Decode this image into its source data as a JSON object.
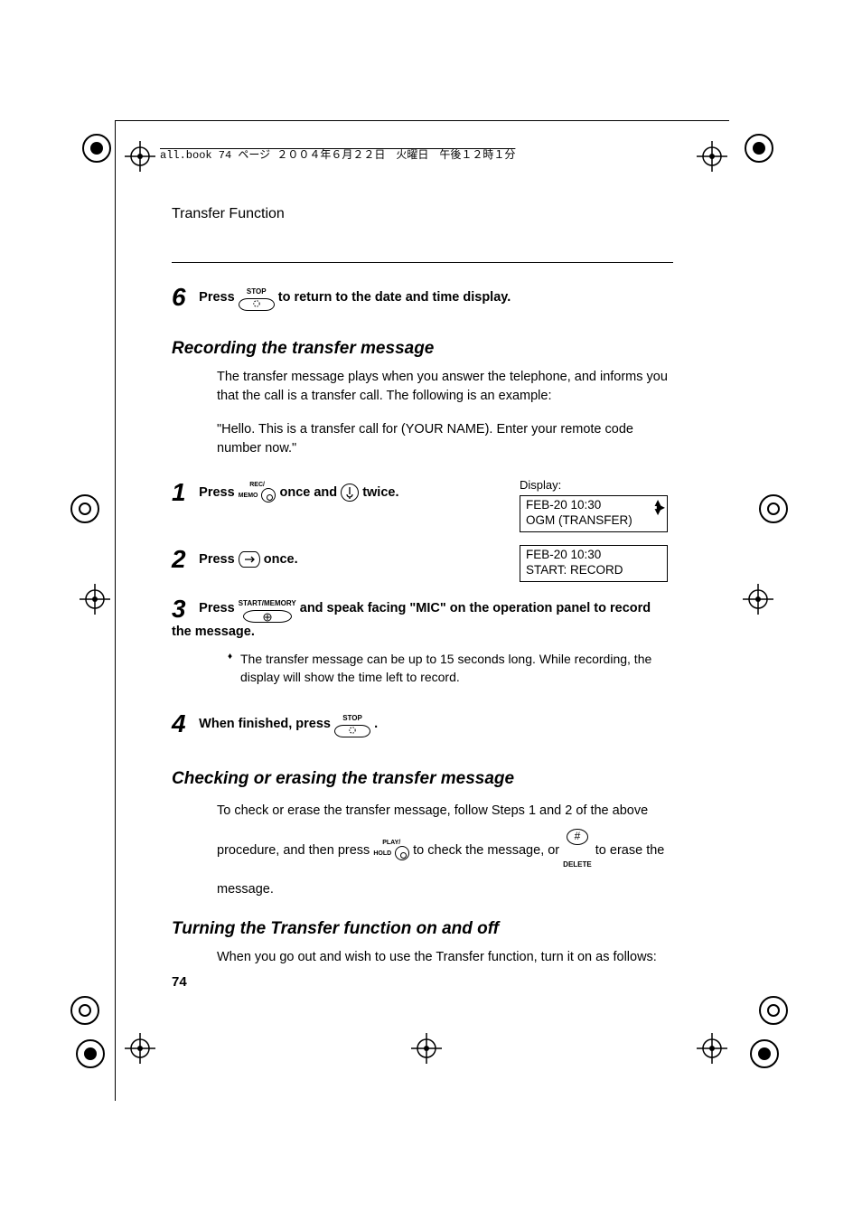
{
  "header": {
    "book_line": "all.book  74 ページ  ２００４年６月２２日　火曜日　午後１２時１分"
  },
  "section_title": "Transfer Function",
  "step6": {
    "num": "6",
    "before": "Press  ",
    "btn_label": "STOP",
    "after": "  to return to the date and time display."
  },
  "recording": {
    "heading": "Recording the transfer message",
    "para1": "The transfer message plays when you answer the telephone, and informs you that the call is a transfer call. The following is an example:",
    "para2": "\"Hello. This is a transfer call for (YOUR NAME). Enter your remote code number now.\""
  },
  "display_label": "Display:",
  "step1": {
    "num": "1",
    "before": "Press  ",
    "btn_label_top": "REC/",
    "btn_label_bot": "MEMO",
    "mid": "  once and  ",
    "after": "  twice.",
    "lcd_line1": "FEB-20  10:30",
    "lcd_line2": "OGM (TRANSFER)"
  },
  "step2": {
    "num": "2",
    "before": "Press  ",
    "after": "  once.",
    "lcd_line1": "FEB-20  10:30",
    "lcd_line2": "START: RECORD"
  },
  "step3": {
    "num": "3",
    "before": "Press  ",
    "btn_label": "START/MEMORY",
    "after": "  and speak facing \"MIC\" on the operation panel to record the message.",
    "bullet": "The transfer message can be up to 15 seconds long. While recording, the display will show the time left to record."
  },
  "step4": {
    "num": "4",
    "before": "When finished, press  ",
    "btn_label": "STOP",
    "after": " ."
  },
  "checking": {
    "heading": "Checking or erasing the transfer message",
    "line1a": "To check or erase the transfer message, follow Steps 1 and 2 of the above ",
    "line1b": "procedure, and then press  ",
    "play_top": "PLAY/",
    "play_bot": "HOLD",
    "mid": "  to check the message, or   ",
    "hash": "#",
    "delete_label": "DELETE",
    "after": "   to erase ",
    "line2": "the message."
  },
  "turning": {
    "heading": "Turning the Transfer function on and off",
    "para": "When you go out and wish to use the Transfer function, turn it on as follows:"
  },
  "page_number": "74"
}
